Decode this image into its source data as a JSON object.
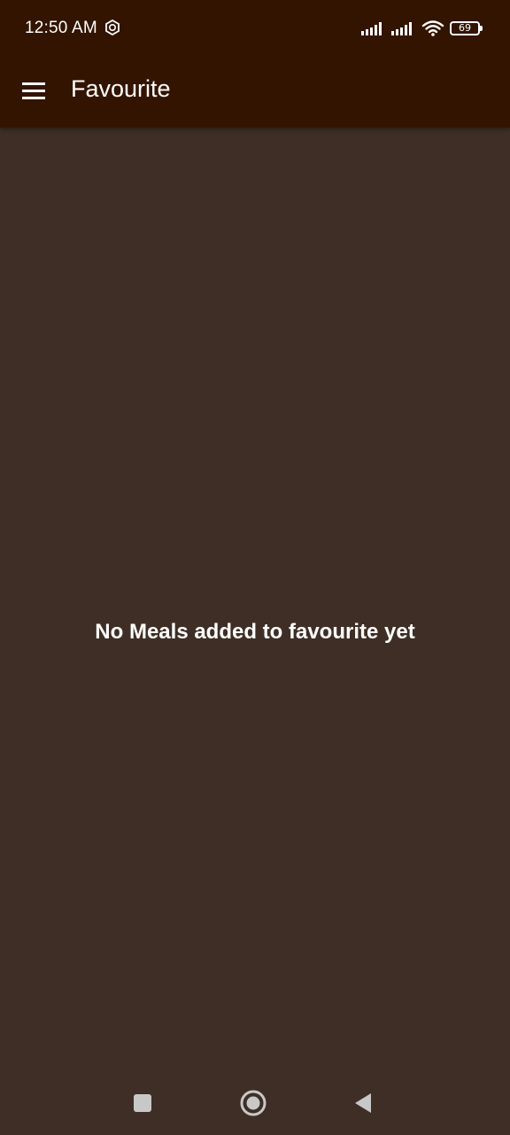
{
  "status_bar": {
    "time": "12:50 AM",
    "battery_level": "69",
    "icons": [
      "shield-icon",
      "signal-icon",
      "signal-icon",
      "wifi-icon",
      "battery-icon"
    ]
  },
  "app_bar": {
    "title": "Favourite",
    "menu_icon": "hamburger-menu-icon"
  },
  "main": {
    "empty_message": "No Meals added to favourite yet"
  },
  "nav_bar": {
    "buttons": [
      "recents-square-icon",
      "home-circle-icon",
      "back-triangle-icon"
    ]
  },
  "colors": {
    "app_bar": "#331400",
    "background": "#3e2e25",
    "text": "#ffffff",
    "nav_icon": "#c8c8c8"
  }
}
